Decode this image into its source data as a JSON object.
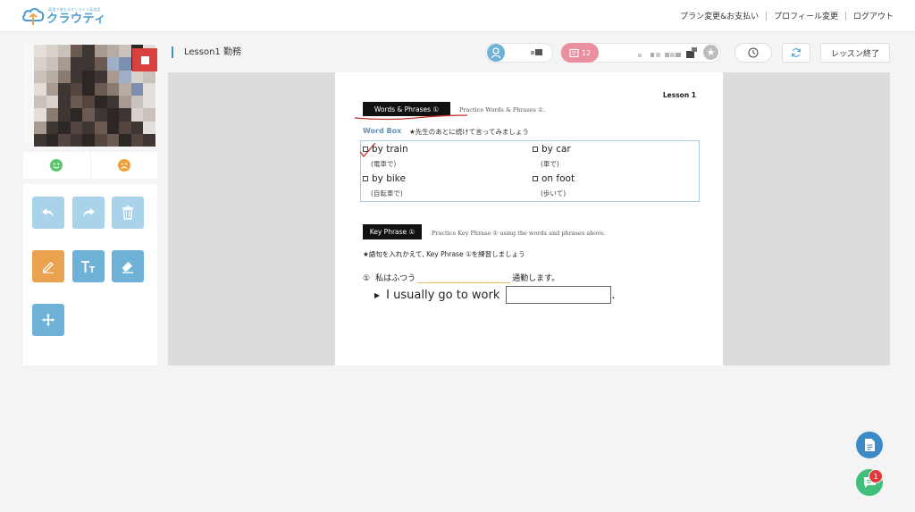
{
  "header": {
    "logo_tagline": "英語で使えるオンライン英会話",
    "logo_name": "クラウティ",
    "nav": [
      "プラン変更&お支払い",
      "プロフィール変更",
      "ログアウト"
    ]
  },
  "lesson": {
    "title": "Lesson1 勤務",
    "end_button": "レッスン終了"
  },
  "status": {
    "ticket_count": "12"
  },
  "material": {
    "lesson_label": "Lesson 1",
    "section1_title": "Words & Phrases ①",
    "section1_note": "Practice Words & Phrases ①.",
    "word_box_title": "Word Box",
    "word_box_instruction": "★先生のあとに続けて言ってみましょう",
    "words": [
      {
        "en": "by train",
        "jp": "(電車で)"
      },
      {
        "en": "by car",
        "jp": "(車で)"
      },
      {
        "en": "by bike",
        "jp": "(自転車で)"
      },
      {
        "en": "on foot",
        "jp": "(歩いて)"
      }
    ],
    "section2_title": "Key Phrase ①",
    "section2_note": "Practice Key Phrase ① using the words and phrases above.",
    "key_instruction": "★語句を入れかえて, Key Phrase ①を練習しましょう",
    "sentence_num": "①",
    "sentence_jp_start": "私はふつう",
    "sentence_jp_end": "通勤します。",
    "sentence_en": "I usually go to work",
    "sentence_en_end": "."
  },
  "chat": {
    "unread": "1"
  },
  "colors": {
    "accent": "#6eb2d8",
    "stop": "#d9413e",
    "pen": "#e9a34f",
    "badge": "#e0393b"
  }
}
